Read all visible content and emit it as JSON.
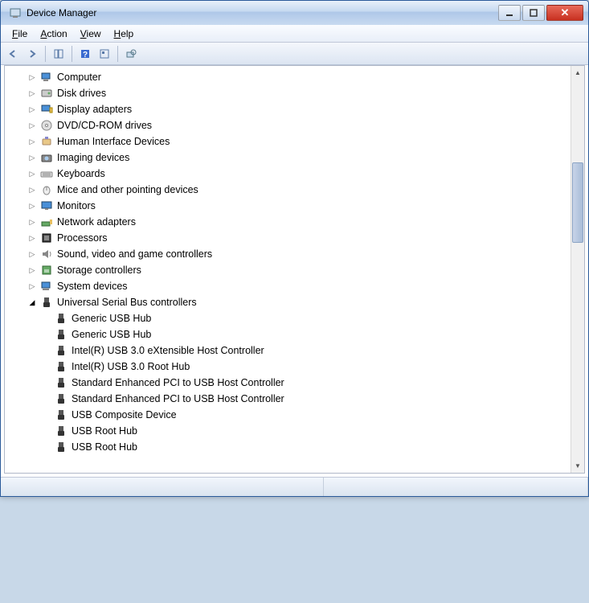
{
  "window": {
    "title": "Device Manager"
  },
  "menu": {
    "file": "File",
    "action": "Action",
    "view": "View",
    "help": "Help"
  },
  "tree": {
    "items": [
      {
        "label": "Computer",
        "icon": "computer"
      },
      {
        "label": "Disk drives",
        "icon": "disk"
      },
      {
        "label": "Display adapters",
        "icon": "display"
      },
      {
        "label": "DVD/CD-ROM drives",
        "icon": "dvd"
      },
      {
        "label": "Human Interface Devices",
        "icon": "hid"
      },
      {
        "label": "Imaging devices",
        "icon": "camera"
      },
      {
        "label": "Keyboards",
        "icon": "keyboard"
      },
      {
        "label": "Mice and other pointing devices",
        "icon": "mouse"
      },
      {
        "label": "Monitors",
        "icon": "monitor"
      },
      {
        "label": "Network adapters",
        "icon": "network"
      },
      {
        "label": "Processors",
        "icon": "cpu"
      },
      {
        "label": "Sound, video and game controllers",
        "icon": "sound"
      },
      {
        "label": "Storage controllers",
        "icon": "storage"
      },
      {
        "label": "System devices",
        "icon": "system"
      }
    ],
    "usb": {
      "label": "Universal Serial Bus controllers",
      "children": [
        "Generic USB Hub",
        "Generic USB Hub",
        "Intel(R) USB 3.0 eXtensible Host Controller",
        "Intel(R) USB 3.0 Root Hub",
        "Standard Enhanced PCI to USB Host Controller",
        "Standard Enhanced PCI to USB Host Controller",
        "USB Composite Device",
        "USB Root Hub",
        "USB Root Hub"
      ]
    }
  }
}
